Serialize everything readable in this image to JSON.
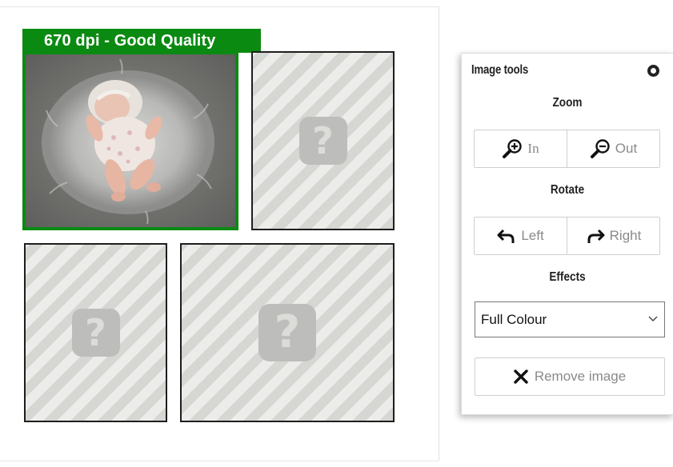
{
  "canvas": {
    "quality_badge": "670 dpi - Good Quality",
    "empty_slot_symbol": "?",
    "photo_description_icon": "baby-photo"
  },
  "colors": {
    "quality_green": "#0b8a12",
    "slot_border": "#1e1e1e",
    "placeholder_stripe_light": "#ececea",
    "placeholder_stripe_dark": "#d6d6d2"
  },
  "panel": {
    "title": "Image tools",
    "close_icon": "close-circle-icon",
    "zoom": {
      "heading": "Zoom",
      "in_label": "In",
      "out_label": "Out",
      "in_icon": "zoom-in-icon",
      "out_icon": "zoom-out-icon"
    },
    "rotate": {
      "heading": "Rotate",
      "left_label": "Left",
      "right_label": "Right",
      "left_icon": "rotate-left-arrow-icon",
      "right_icon": "rotate-right-arrow-icon"
    },
    "effects": {
      "heading": "Effects",
      "selected": "Full Colour"
    },
    "remove": {
      "label": "Remove image",
      "icon": "x-icon"
    }
  }
}
